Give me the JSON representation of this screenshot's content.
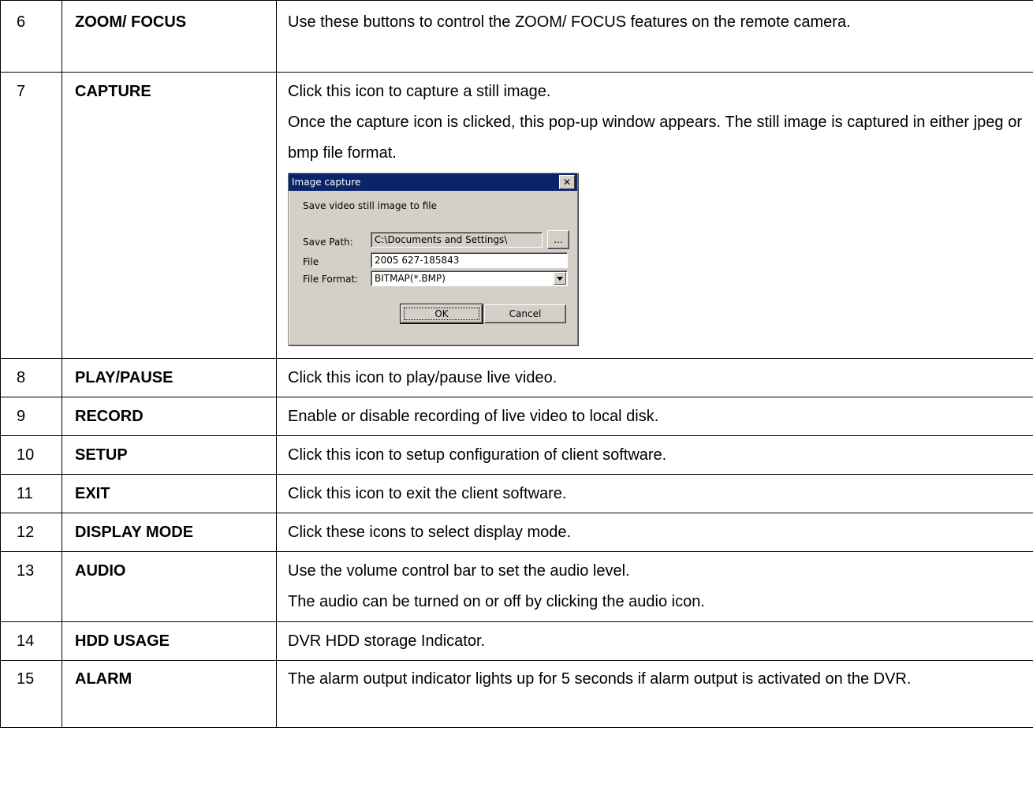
{
  "rows": [
    {
      "num": "6",
      "term": "ZOOM/ FOCUS",
      "desc": [
        "Use these buttons to control the ZOOM/ FOCUS features on the remote camera."
      ]
    },
    {
      "num": "7",
      "term": "CAPTURE",
      "desc": [
        "Click this icon to capture a still image.",
        "Once the capture icon is clicked, this pop-up window appears. The still image is captured in either jpeg or bmp file format."
      ]
    },
    {
      "num": "8",
      "term": "PLAY/PAUSE",
      "desc": [
        "Click this icon to play/pause live video."
      ]
    },
    {
      "num": "9",
      "term": "RECORD",
      "desc": [
        "Enable or disable recording of live video to local disk."
      ]
    },
    {
      "num": "10",
      "term": "SETUP",
      "desc": [
        "Click this icon to setup configuration of client software."
      ]
    },
    {
      "num": "11",
      "term": "EXIT",
      "desc": [
        "Click this icon to exit the client software."
      ]
    },
    {
      "num": "12",
      "term": "DISPLAY MODE",
      "desc": [
        "Click these icons to select display mode."
      ]
    },
    {
      "num": "13",
      "term": "AUDIO",
      "desc": [
        "Use the volume control bar to set the audio level.",
        "The audio can be turned on or off by clicking the audio icon."
      ]
    },
    {
      "num": "14",
      "term": "HDD USAGE",
      "desc": [
        "DVR HDD storage Indicator."
      ]
    },
    {
      "num": "15",
      "term": "ALARM",
      "desc": [
        "The alarm output indicator lights up for 5 seconds if alarm output is activated on the DVR."
      ]
    }
  ],
  "dialog": {
    "title": "Image capture",
    "close_icon": "close-icon",
    "heading": "Save video still image to file",
    "save_path_label": "Save Path:",
    "save_path_value": "C:\\Documents and Settings\\",
    "browse_label": "...",
    "file_label": "File",
    "file_value": "2005 627-185843",
    "format_label": "File Format:",
    "format_value": "BITMAP(*.BMP)",
    "ok_label": "OK",
    "cancel_label": "Cancel"
  }
}
